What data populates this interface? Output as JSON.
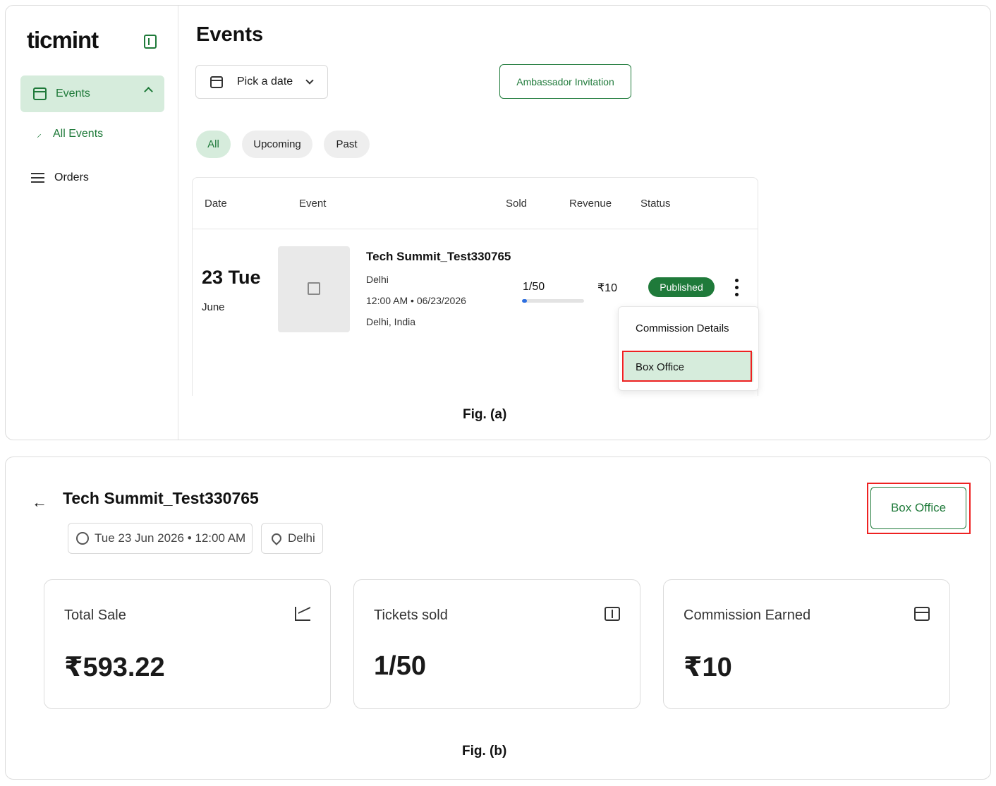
{
  "fig_a": {
    "caption": "Fig. (a)",
    "sidebar": {
      "logo": "ticmint",
      "items": [
        {
          "label": "Events"
        },
        {
          "label": "All Events"
        },
        {
          "label": "Orders"
        }
      ]
    },
    "page_title": "Events",
    "date_picker": {
      "label": "Pick a date"
    },
    "ambassador_button": "Ambassador Invitation",
    "filters": [
      "All",
      "Upcoming",
      "Past"
    ],
    "table": {
      "headers": [
        "Date",
        "Event",
        "Sold",
        "Revenue",
        "Status"
      ],
      "rows": [
        {
          "day": "23 Tue",
          "month": "June",
          "name": "Tech Summit_Test330765",
          "city": "Delhi",
          "datetime": "12:00 AM • 06/23/2026",
          "location": "Delhi, India",
          "sold": "1/50",
          "sold_fraction": 0.02,
          "revenue": "₹10",
          "status": "Published"
        }
      ]
    },
    "menu": {
      "items": [
        "Commission Details",
        "Box Office"
      ],
      "highlighted": "Box Office"
    }
  },
  "fig_b": {
    "caption": "Fig. (b)",
    "title": "Tech Summit_Test330765",
    "date_chip": "Tue 23 Jun 2026 • 12:00 AM",
    "location_chip": "Delhi",
    "box_office_button": "Box Office",
    "cards": [
      {
        "label": "Total Sale",
        "value": "₹593.22",
        "icon": "trend-chart-icon"
      },
      {
        "label": "Tickets sold",
        "value": "1/50",
        "icon": "ticket-icon"
      },
      {
        "label": "Commission Earned",
        "value": "₹10",
        "icon": "wallet-icon"
      }
    ]
  },
  "colors": {
    "brand_green": "#1f7a3a",
    "light_green": "#d6ecdc",
    "highlight_red": "#ee2222",
    "progress_blue": "#2e6fe0"
  }
}
